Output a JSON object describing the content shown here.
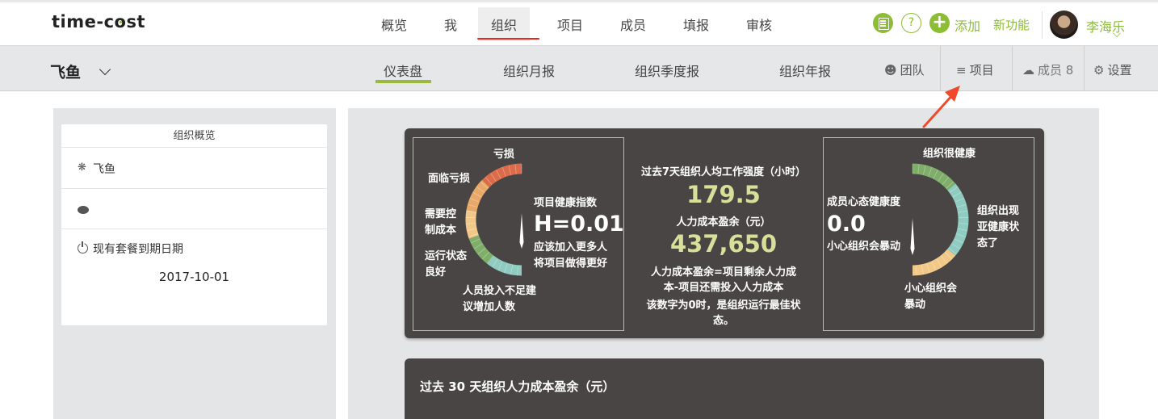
{
  "app": {
    "logo_main": "time-c",
    "logo_o": "o",
    "logo_tail": "st"
  },
  "topnav": {
    "items": [
      {
        "label": "概览"
      },
      {
        "label": "我"
      },
      {
        "label": "组织"
      },
      {
        "label": "项目"
      },
      {
        "label": "成员"
      },
      {
        "label": "填报"
      },
      {
        "label": "审核"
      }
    ],
    "active": "组织",
    "help_glyph": "?",
    "add_glyph": "+",
    "add_label": "添加",
    "new_feature": "新功能",
    "user_name": "李海乐"
  },
  "subnav": {
    "org_name": "飞鱼",
    "tabs": [
      {
        "label": "仪表盘"
      },
      {
        "label": "组织月报"
      },
      {
        "label": "组织季度报"
      },
      {
        "label": "组织年报"
      }
    ],
    "active_tab": "仪表盘",
    "team": "团队",
    "project": "项目",
    "members": "成员 8",
    "settings": "设置"
  },
  "overview": {
    "title": "组织概览",
    "org_name": "飞鱼",
    "expire_label": "现有套餐到期日期",
    "expire_date": "2017-10-01"
  },
  "health": {
    "zones": [
      "亏损",
      "面临亏损",
      "需要控制成本",
      "运行状态良好",
      "人员投入不足建议增加人数"
    ],
    "zone_labels": {
      "loss": "亏损",
      "near_loss": "面临亏损",
      "control_1": "需要控",
      "control_2": "制成本",
      "good_1": "运行状态",
      "good_2": "良好",
      "under_1": "人员投入不足建",
      "under_2": "议增加人数"
    },
    "index_label": "项目健康指数",
    "index_value": "H=0.01",
    "advice_1": "应该加入更多人",
    "advice_2": "将项目做得更好",
    "needle_value": 0.01
  },
  "intensity": {
    "title": "过去7天组织人均工作强度（小时）",
    "value": "179.5",
    "surplus_title": "人力成本盈余（元）",
    "surplus_value": "437,650",
    "note_1": "人力成本盈余=项目剩余人力成",
    "note_2": "本-项目还需投入人力成本",
    "note_3": "该数字为0时，是组织运行最佳状",
    "note_4": "态。"
  },
  "mood": {
    "top_label": "组织很健康",
    "right_1": "组织出现",
    "right_2": "亚健康状",
    "right_3": "态了",
    "bottom_1": "小心组织会",
    "bottom_2": "暴动",
    "index_label": "成员心态健康度",
    "index_value": "0.0",
    "advice": "小心组织会暴动",
    "needle_value": 0.0
  },
  "cost_chart": {
    "title": "过去 30 天组织人力成本盈余（元）"
  },
  "colors": {
    "accent": "#8dbd33",
    "gauge_red": "#dc6b4a",
    "gauge_orange": "#e8a868",
    "gauge_yellow": "#f2c888",
    "gauge_green": "#7fae6a",
    "gauge_teal": "#8fcbc0",
    "panel_dark": "#484544",
    "value_yellow": "#d9de99",
    "nav_underline": "#e8281e"
  }
}
